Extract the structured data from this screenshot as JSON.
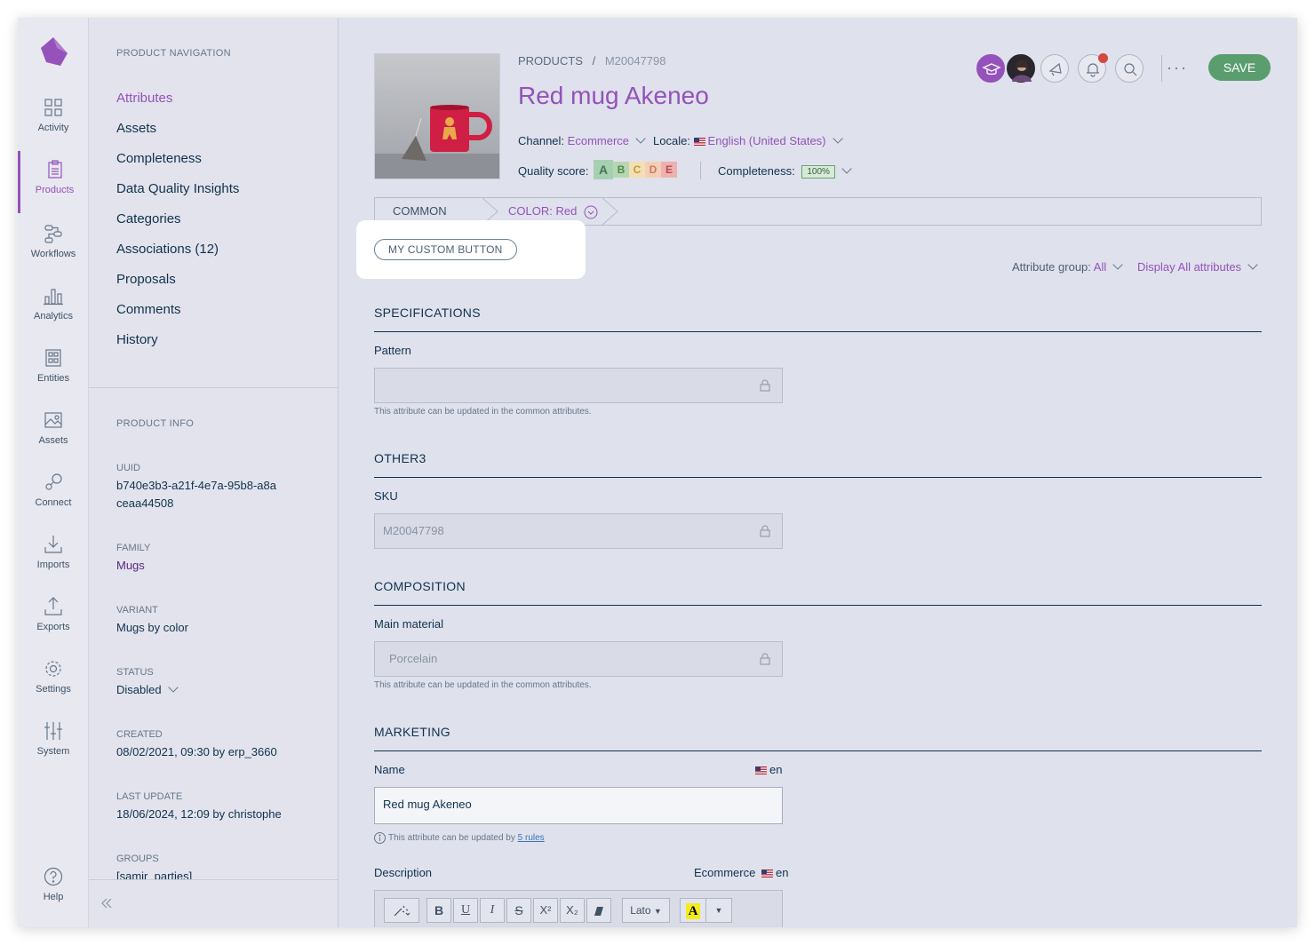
{
  "nav": {
    "items": [
      {
        "label": "Activity",
        "icon": "activity-icon"
      },
      {
        "label": "Products",
        "icon": "products-icon"
      },
      {
        "label": "Workflows",
        "icon": "workflows-icon"
      },
      {
        "label": "Analytics",
        "icon": "analytics-icon"
      },
      {
        "label": "Entities",
        "icon": "entities-icon"
      },
      {
        "label": "Assets",
        "icon": "assets-icon"
      },
      {
        "label": "Connect",
        "icon": "connect-icon"
      },
      {
        "label": "Imports",
        "icon": "imports-icon"
      },
      {
        "label": "Exports",
        "icon": "exports-icon"
      },
      {
        "label": "Settings",
        "icon": "settings-icon"
      },
      {
        "label": "System",
        "icon": "system-icon"
      }
    ],
    "help": "Help",
    "active": "Products",
    "accent": "#9452ba"
  },
  "product_nav": {
    "title": "PRODUCT NAVIGATION",
    "links": [
      "Attributes",
      "Assets",
      "Completeness",
      "Data Quality Insights",
      "Categories",
      "Associations (12)",
      "Proposals",
      "Comments",
      "History"
    ],
    "active": "Attributes"
  },
  "product_info": {
    "title": "PRODUCT INFO",
    "uuid_label": "UUID",
    "uuid_value": "b740e3b3-a21f-4e7a-95b8-a8aceaa44508",
    "family_label": "FAMILY",
    "family_value": "Mugs",
    "variant_label": "VARIANT",
    "variant_value": "Mugs by color",
    "status_label": "STATUS",
    "status_value": "Disabled",
    "created_label": "CREATED",
    "created_value": "08/02/2021, 09:30 by erp_3660",
    "last_update_label": "LAST UPDATE",
    "last_update_value": "18/06/2024, 12:09 by christophe",
    "groups_label": "GROUPS",
    "groups_value": "[samir_parties]"
  },
  "header": {
    "breadcrumb_root": "PRODUCTS",
    "breadcrumb_sep": "/",
    "breadcrumb_current": "M20047798",
    "title": "Red mug Akeneo",
    "channel_label": "Channel:",
    "channel_value": "Ecommerce",
    "locale_label": "Locale:",
    "locale_value": "English (United States)",
    "quality_label": "Quality score:",
    "quality_grades": [
      "A",
      "B",
      "C",
      "D",
      "E"
    ],
    "completeness_label": "Completeness:",
    "completeness_value": "100%",
    "more": "···",
    "save": "SAVE",
    "save_color": "#5a9e6f"
  },
  "tabs": {
    "common": "COMMON",
    "color": "COLOR: Red"
  },
  "custom_button": "MY CUSTOM BUTTON",
  "filters": {
    "group_label": "Attribute group:",
    "group_value": "All",
    "display_value": "Display All attributes"
  },
  "sections": {
    "specifications": {
      "title": "SPECIFICATIONS",
      "pattern_label": "Pattern",
      "pattern_value": "",
      "pattern_help": "This attribute can be updated in the common attributes."
    },
    "other3": {
      "title": "OTHER3",
      "sku_label": "SKU",
      "sku_value": "M20047798"
    },
    "composition": {
      "title": "COMPOSITION",
      "material_label": "Main material",
      "material_value": "Porcelain",
      "material_help": "This attribute can be updated in the common attributes."
    },
    "marketing": {
      "title": "MARKETING",
      "name_label": "Name",
      "name_locale": "en",
      "name_value": "Red mug Akeneo",
      "name_help_prefix": "This attribute can be updated by",
      "name_help_link": "5 rules",
      "description_label": "Description",
      "description_scope": "Ecommerce",
      "description_locale": "en"
    }
  },
  "editor": {
    "font": "Lato",
    "buttons": [
      "B",
      "U",
      "I",
      "S",
      "X²",
      "X₂"
    ]
  }
}
